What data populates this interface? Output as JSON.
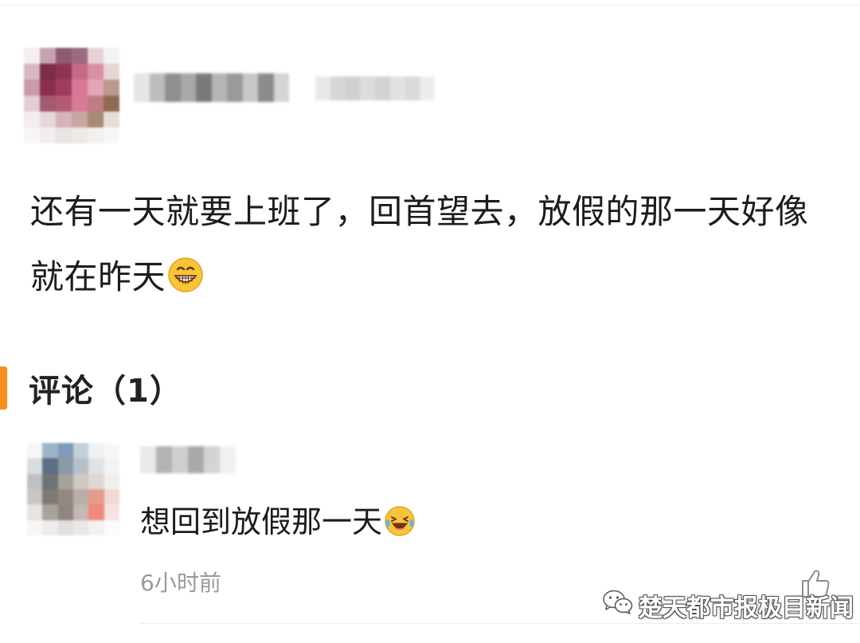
{
  "post": {
    "avatar_colors": [
      "#f4efef",
      "#c6a3b0",
      "#8e5b72",
      "#9b6a80",
      "#e6d1d6",
      "#f5f2f2",
      "#d8b8c0",
      "#7d2d48",
      "#8c3553",
      "#c76a86",
      "#d98fa5",
      "#e7d6d6",
      "#c99aa7",
      "#8a2f4d",
      "#a13d5c",
      "#d77997",
      "#e4a6b7",
      "#b99a8c",
      "#e3cfd3",
      "#a25a70",
      "#b35a74",
      "#d77b94",
      "#c07c83",
      "#8f6a52",
      "#f3eded",
      "#e5d7da",
      "#d4b3bb",
      "#c9a79f",
      "#a88b74",
      "#e7ddd6",
      "#f7f5f5",
      "#f2eeee",
      "#e9e3e3",
      "#eee9e6",
      "#f3f0ee",
      "#f8f7f7"
    ],
    "username_blur_colors": [
      "#e6e6e6",
      "#bdbdbd",
      "#8f8f8f",
      "#a8a8a8",
      "#7a7a7a",
      "#b5b5b5",
      "#9a9a9a",
      "#c8c8c8",
      "#8c8c8c",
      "#d5d5d5"
    ],
    "meta_blur_colors": [
      "#e8e8e8",
      "#d6d6d6",
      "#cfcfcf",
      "#dcdcdc",
      "#d2d2d2",
      "#e1e1e1",
      "#d9d9d9",
      "#ececec"
    ],
    "content": "还有一天就要上班了，回首望去，放假的那一天好像就在昨天",
    "emoji_name": "grinning-face-icon"
  },
  "comments_section": {
    "title": "评论（1）",
    "accent_color": "#f7901e"
  },
  "comment": {
    "avatar_colors": [
      "#f6f6f6",
      "#9fb3c8",
      "#7d9bb8",
      "#c4cfd9",
      "#eef1f3",
      "#f7f7f7",
      "#d8dde2",
      "#5c6f84",
      "#8a9aa8",
      "#b7c0c8",
      "#dfe3e6",
      "#f3f3f3",
      "#bcc1c6",
      "#6f7378",
      "#a5a29c",
      "#cfcac3",
      "#e0d8d2",
      "#f1eeee",
      "#c9c6c2",
      "#7f7a74",
      "#938a83",
      "#b9aea6",
      "#e59a8e",
      "#f2d8d3",
      "#e6e4e2",
      "#a9a29b",
      "#8e8680",
      "#c4b8b0",
      "#ef8a7c",
      "#f6e4e1",
      "#f6f6f6",
      "#eeeceb",
      "#e3dfdc",
      "#ebe7e4",
      "#f4f1f0",
      "#fbfbfb"
    ],
    "username_blur_colors": [
      "#e9e9e9",
      "#b3b3b3",
      "#cfcfcf",
      "#a9a9a9",
      "#d4d4d4",
      "#f0f0f0"
    ],
    "text": "想回到放假那一天",
    "emoji_name": "laughing-crying-face-icon",
    "time": "6小时前",
    "like_icon": "thumbs-up-icon"
  },
  "watermark": {
    "text": "楚天都市报极目新闻",
    "icon": "wechat-icon"
  }
}
